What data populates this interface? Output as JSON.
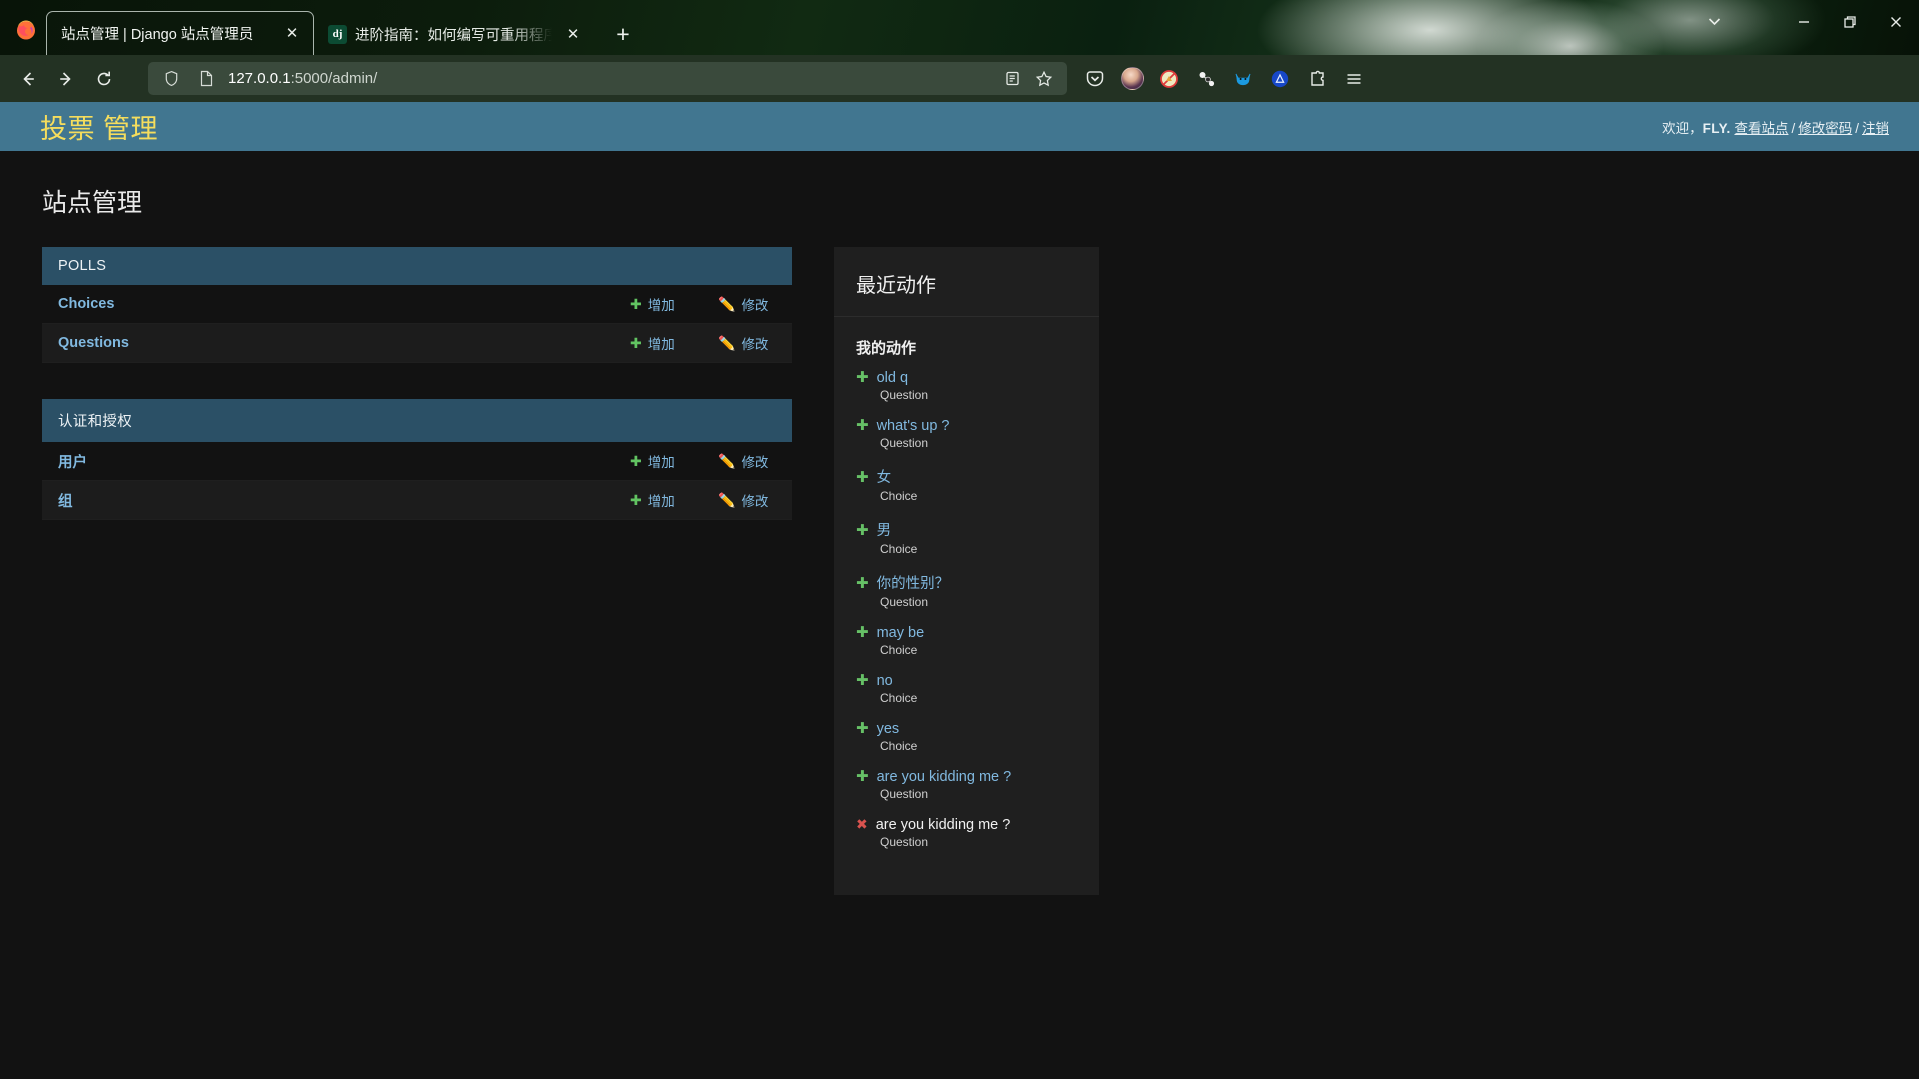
{
  "browser": {
    "app_icon": "firefox-icon",
    "tabs": [
      {
        "title": "站点管理 | Django 站点管理员",
        "favicon": "none",
        "active": true,
        "close_label": "✕"
      },
      {
        "title": "进阶指南：如何编写可重用程序",
        "favicon": "django-favicon",
        "favicon_text": "dj",
        "active": false,
        "close_label": "✕"
      }
    ],
    "new_tab_label": "+",
    "window_controls": {
      "tab_list": "⌄",
      "minimize": "—",
      "restore": "❐",
      "close": "✕"
    },
    "nav": {
      "back": "←",
      "forward": "→",
      "reload": "⟳"
    },
    "url": {
      "host": "127.0.0.1",
      "rest": ":5000/admin/",
      "shield_icon": "shield-icon",
      "page_icon": "page-icon"
    },
    "urlbar_actions": {
      "reader": "reader-view-icon",
      "bookmark": "star-icon"
    },
    "extensions": [
      "pocket-icon",
      "account-avatar-icon",
      "adblock-icon",
      "molecule-icon",
      "cat-icon",
      "triangle-icon",
      "puzzle-extensions-icon",
      "app-menu-icon"
    ]
  },
  "admin": {
    "branding": "投票 管理",
    "user_greeting": "欢迎，",
    "user_name": "FLY.",
    "user_links": [
      {
        "label": "查看站点"
      },
      {
        "label": "修改密码"
      },
      {
        "label": "注销"
      }
    ],
    "link_separator": "/",
    "page_title": "站点管理",
    "modules": [
      {
        "caption": "POLLS",
        "uppercase": true,
        "rows": [
          {
            "name": "Choices",
            "add_label": "增加",
            "change_label": "修改"
          },
          {
            "name": "Questions",
            "add_label": "增加",
            "change_label": "修改"
          }
        ]
      },
      {
        "caption": "认证和授权",
        "uppercase": false,
        "rows": [
          {
            "name": "用户",
            "add_label": "增加",
            "change_label": "修改"
          },
          {
            "name": "组",
            "add_label": "增加",
            "change_label": "修改"
          }
        ]
      }
    ],
    "recent": {
      "title": "最近动作",
      "subtitle": "我的动作",
      "items": [
        {
          "icon": "add",
          "object": "old q",
          "type": "Question"
        },
        {
          "icon": "add",
          "object": "what's up ?",
          "type": "Question"
        },
        {
          "icon": "add",
          "object": "女",
          "type": "Choice"
        },
        {
          "icon": "add",
          "object": "男",
          "type": "Choice"
        },
        {
          "icon": "add",
          "object": "你的性别？",
          "type": "Question"
        },
        {
          "icon": "add",
          "object": "may be",
          "type": "Choice"
        },
        {
          "icon": "add",
          "object": "no",
          "type": "Choice"
        },
        {
          "icon": "add",
          "object": "yes",
          "type": "Choice"
        },
        {
          "icon": "add",
          "object": "are you kidding me ?",
          "type": "Question"
        },
        {
          "icon": "delete",
          "object": "are you kidding me ?",
          "type": "Question"
        }
      ]
    }
  },
  "colors": {
    "header_bg": "#417690",
    "branding": "#f5dd5d",
    "module_caption_bg": "#2b5066",
    "link": "#81b9e0",
    "add_icon": "#62c462",
    "delete_icon": "#d9534f",
    "page_bg": "#121212",
    "panel_bg": "#1f1f1f"
  }
}
